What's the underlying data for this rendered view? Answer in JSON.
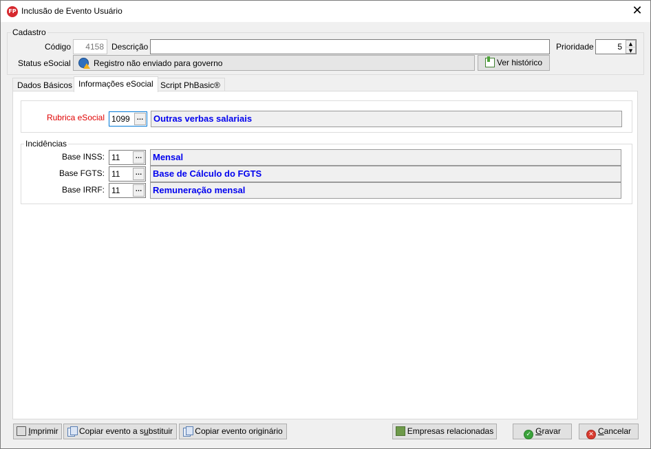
{
  "window": {
    "title": "Inclusão de Evento Usuário",
    "app_icon_text": "FP",
    "close_glyph": "✕"
  },
  "cadastro": {
    "group_label": "Cadastro",
    "codigo_label": "Código",
    "codigo_value": "4158",
    "descricao_label": "Descrição",
    "descricao_value": "",
    "prioridade_label": "Prioridade",
    "prioridade_value": "5",
    "status_label": "Status eSocial",
    "status_text": "Registro não enviado para governo",
    "status_icon": "globe-warning-icon",
    "historico_button": "Ver histórico"
  },
  "tabs": [
    {
      "label": "Dados Básicos",
      "active": false
    },
    {
      "label": "Informações eSocial",
      "active": true
    },
    {
      "label": "Script PhBasic®",
      "active": false
    }
  ],
  "esocial": {
    "rubrica_label": "Rubrica eSocial",
    "rubrica_label_color": "#e00000",
    "rubrica_code": "1099",
    "rubrica_desc": "Outras verbas salariais",
    "incidencias_label": "Incidências",
    "incidencias": [
      {
        "label": "Base INSS:",
        "code": "11",
        "desc": "Mensal"
      },
      {
        "label": "Base FGTS:",
        "code": "11",
        "desc": "Base de Cálculo do FGTS"
      },
      {
        "label": "Base IRRF:",
        "code": "11",
        "desc": "Remuneração mensal"
      }
    ],
    "ellipsis": "…",
    "desc_color": "#0000ee"
  },
  "footer": {
    "imprimir": {
      "pre": "",
      "ul": "I",
      "post": "mprimir"
    },
    "copiar_substituir": {
      "pre": "Copiar evento a s",
      "ul": "u",
      "post": "bstituir"
    },
    "copiar_originario": "Copiar evento originário",
    "empresas": "Empresas relacionadas",
    "gravar": {
      "pre": "",
      "ul": "G",
      "post": "ravar"
    },
    "cancelar": {
      "pre": "",
      "ul": "C",
      "post": "ancelar"
    }
  }
}
